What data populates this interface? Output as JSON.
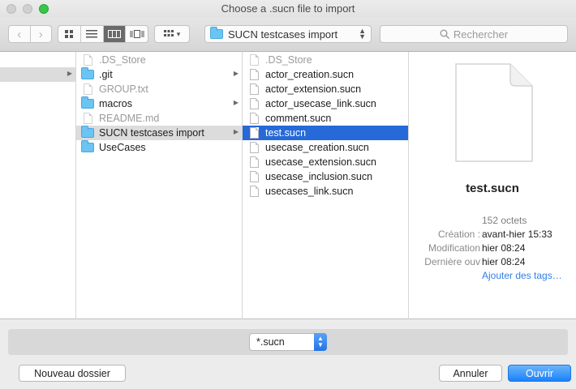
{
  "window": {
    "title": "Choose a .sucn file to import"
  },
  "toolbar": {
    "back_label": "‹",
    "forward_label": "›",
    "path": "SUCN testcases import",
    "search_placeholder": "Rechercher"
  },
  "columns": {
    "col2": [
      {
        "name": ".DS_Store",
        "kind": "file",
        "dim": true,
        "folder": false
      },
      {
        "name": ".git",
        "kind": "folder",
        "dim": false,
        "folder": true
      },
      {
        "name": "GROUP.txt",
        "kind": "file",
        "dim": true,
        "folder": false
      },
      {
        "name": "macros",
        "kind": "folder",
        "dim": false,
        "folder": true
      },
      {
        "name": "README.md",
        "kind": "file",
        "dim": true,
        "folder": false
      },
      {
        "name": "SUCN testcases import",
        "kind": "folder",
        "dim": false,
        "folder": true,
        "selected": true
      },
      {
        "name": "UseCases",
        "kind": "folder",
        "dim": false,
        "folder": false
      }
    ],
    "col3": [
      {
        "name": ".DS_Store",
        "dim": true
      },
      {
        "name": "actor_creation.sucn",
        "dim": false
      },
      {
        "name": "actor_extension.sucn",
        "dim": false
      },
      {
        "name": "actor_usecase_link.sucn",
        "dim": false
      },
      {
        "name": "comment.sucn",
        "dim": false
      },
      {
        "name": "test.sucn",
        "dim": false,
        "selected": true
      },
      {
        "name": "usecase_creation.sucn",
        "dim": false
      },
      {
        "name": "usecase_extension.sucn",
        "dim": false
      },
      {
        "name": "usecase_inclusion.sucn",
        "dim": false
      },
      {
        "name": "usecases_link.sucn",
        "dim": false
      }
    ]
  },
  "preview": {
    "name": "test.sucn",
    "size": "152 octets",
    "created_label": "Création :",
    "created_value": "avant-hier 15:33",
    "modified_label": "Modification",
    "modified_value": "hier 08:24",
    "opened_label": "Dernière ouv",
    "opened_value": "hier 08:24",
    "tags_link": "Ajouter des tags…"
  },
  "bottom": {
    "filter_value": "*.sucn",
    "new_folder_label": "Nouveau dossier",
    "cancel_label": "Annuler",
    "open_label": "Ouvrir"
  },
  "colors": {
    "selection": "#2669d8",
    "folder": "#6cc4f2",
    "primary_button": "#1a82fb",
    "link": "#2f7ee6"
  }
}
